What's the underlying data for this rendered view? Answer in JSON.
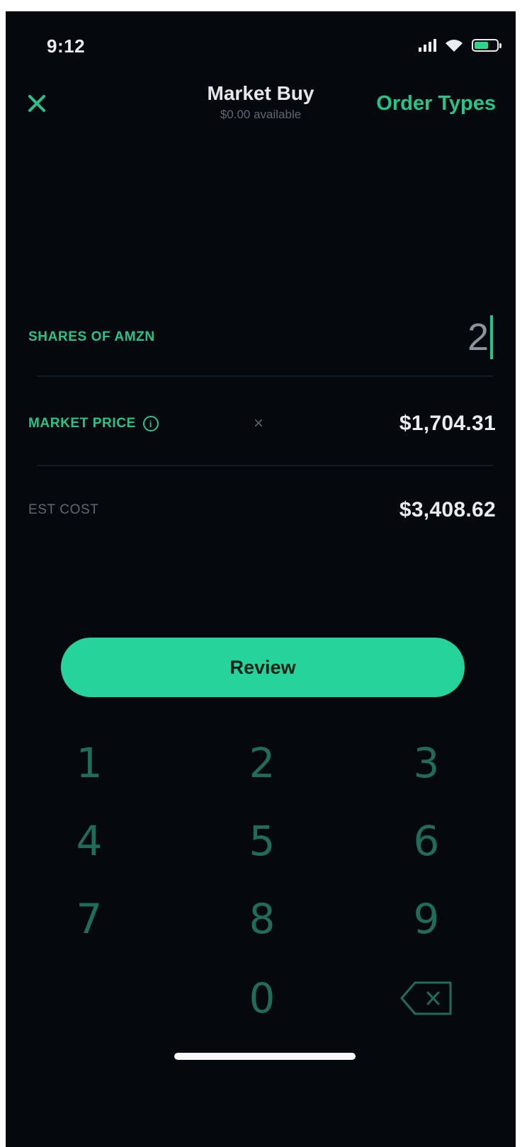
{
  "status_bar": {
    "time": "9:12",
    "signal_icon": "cellular-signal-icon",
    "wifi_icon": "wifi-icon",
    "battery_icon": "battery-icon",
    "battery_level": 0.55
  },
  "header": {
    "close_icon": "close-icon",
    "title": "Market Buy",
    "subtitle": "$0.00 available",
    "order_types_label": "Order Types"
  },
  "order_form": {
    "shares_label": "SHARES OF AMZN",
    "shares_value": "2",
    "market_price_label": "MARKET PRICE",
    "market_price_info_icon": "info-icon",
    "multiply_sign": "×",
    "market_price_value": "$1,704.31",
    "est_cost_label": "EST COST",
    "est_cost_value": "$3,408.62"
  },
  "review_button_label": "Review",
  "keypad": {
    "keys": [
      "1",
      "2",
      "3",
      "4",
      "5",
      "6",
      "7",
      "8",
      "9",
      "0"
    ],
    "backspace_icon": "backspace-icon"
  },
  "colors": {
    "background": "#05090e",
    "accent": "#26c48b",
    "button": "#26d49b",
    "keypad_digit": "#1f6c58",
    "label_muted": "#5e6870",
    "text_primary": "#e8ecee"
  }
}
